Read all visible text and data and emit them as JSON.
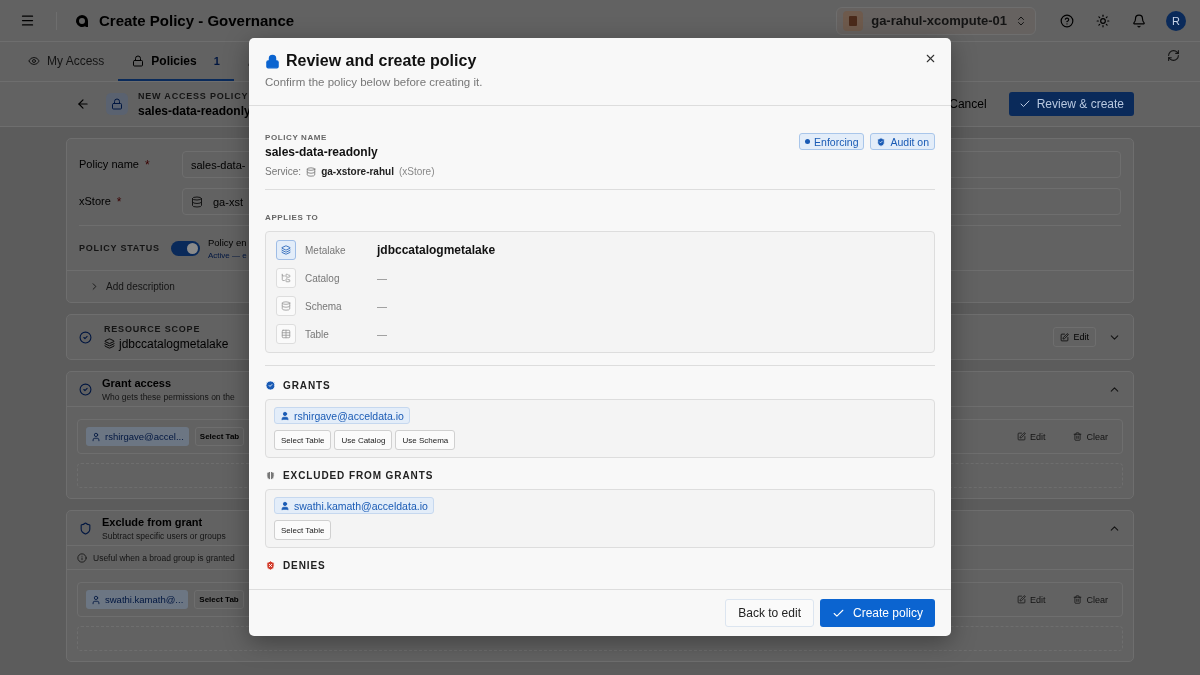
{
  "app_header": {
    "title": "Create Policy - Governance",
    "workspace": "ga-rahul-xcompute-01",
    "avatar": "R"
  },
  "tabs": [
    {
      "label": "My Access",
      "selected": false
    },
    {
      "label": "Policies",
      "count": "1",
      "selected": true
    },
    {
      "selected": false
    }
  ],
  "page_header": {
    "eyebrow": "NEW ACCESS POLICY",
    "name": "sales-data-readonly",
    "cancel": "Cancel",
    "submit": "Review & create"
  },
  "form": {
    "fields": [
      {
        "label": "Policy name",
        "required_mark": "*",
        "value": "sales-data-",
        "kind": "text"
      },
      {
        "label": "xStore",
        "required_mark": "*",
        "value": "ga-xst",
        "kind": "store"
      }
    ],
    "status_label": "POLICY STATUS",
    "status_on": true,
    "status_title": "Policy en",
    "status_note": "Active — e",
    "add_description": "Add description"
  },
  "scope": {
    "eyebrow": "RESOURCE SCOPE",
    "value": "jdbccatalogmetalake",
    "edit": "Edit"
  },
  "rule_sections": [
    {
      "kind": "grant",
      "title": "Grant access",
      "subtitle": "Who gets these permissions on the",
      "rule": {
        "principal": "rshirgave@accel...",
        "action": "Select Tab",
        "edit": "Edit",
        "clear": "Clear"
      }
    },
    {
      "kind": "exclude",
      "title": "Exclude from grant",
      "subtitle": "Subtract specific users or groups",
      "note": "Useful when a broad group is granted",
      "rule": {
        "principal": "swathi.kamath@...",
        "action": "Select Tab",
        "edit": "Edit",
        "clear": "Clear"
      }
    }
  ],
  "modal": {
    "title": "Review and create policy",
    "subtitle": "Confirm the policy below before creating it.",
    "policy_label": "POLICY NAME",
    "policy_name": "sales-data-readonly",
    "service_label": "Service:",
    "service_name": "ga-xstore-rahul",
    "service_type": "(xStore)",
    "badges": [
      {
        "kind": "status",
        "label": "Enforcing"
      },
      {
        "kind": "audit",
        "label": "Audit on"
      }
    ],
    "applies_label": "APPLIES TO",
    "scope_rows": [
      {
        "kind": "metalake",
        "label": "Metalake",
        "value": "jdbccatalogmetalake",
        "set": true
      },
      {
        "kind": "catalog",
        "label": "Catalog",
        "value": "—",
        "set": false
      },
      {
        "kind": "schema",
        "label": "Schema",
        "value": "—",
        "set": false
      },
      {
        "kind": "table",
        "label": "Table",
        "value": "—",
        "set": false
      }
    ],
    "sections": [
      {
        "kind": "grants",
        "title": "GRANTS",
        "principals": [
          "rshirgave@acceldata.io"
        ],
        "privileges": [
          "Select Table",
          "Use Catalog",
          "Use Schema"
        ]
      },
      {
        "kind": "excluded",
        "title": "EXCLUDED FROM GRANTS",
        "principals": [
          "swathi.kamath@acceldata.io"
        ],
        "privileges": [
          "Select Table"
        ]
      },
      {
        "kind": "denies",
        "title": "DENIES"
      }
    ],
    "back": "Back to edit",
    "create": "Create policy"
  }
}
